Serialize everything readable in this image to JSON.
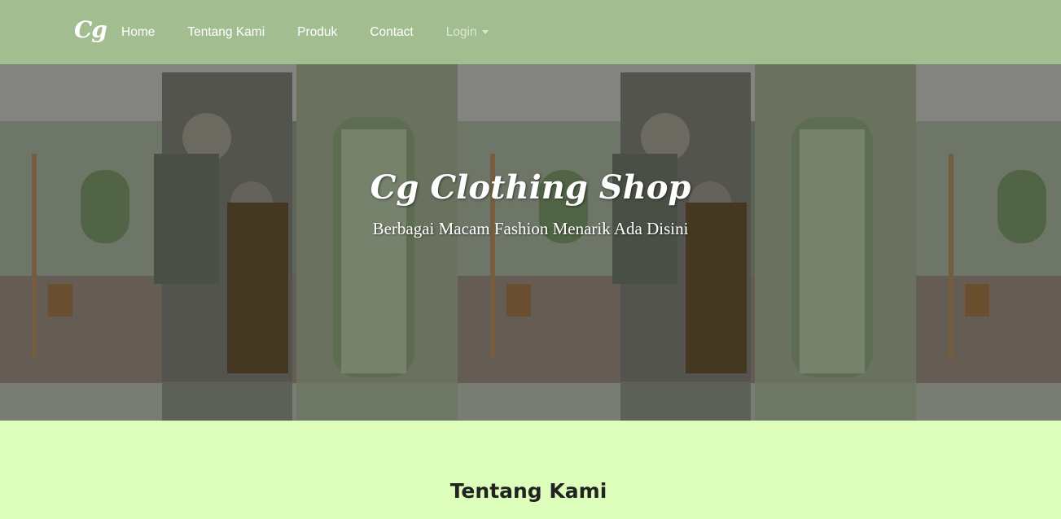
{
  "navbar": {
    "brand": "Cg",
    "links": [
      {
        "label": "Home"
      },
      {
        "label": "Tentang Kami"
      },
      {
        "label": "Produk"
      },
      {
        "label": "Contact"
      },
      {
        "label": "Login",
        "dropdown": true
      }
    ],
    "bg_color": "#a2be91"
  },
  "hero": {
    "title": "Cg Clothing Shop",
    "subtitle": "Berbagai Macam Fashion Menarik Ada Disini"
  },
  "about": {
    "heading": "Tentang Kami"
  },
  "colors": {
    "page_bg": "#ddfdbb",
    "accent": "#a2be91"
  }
}
